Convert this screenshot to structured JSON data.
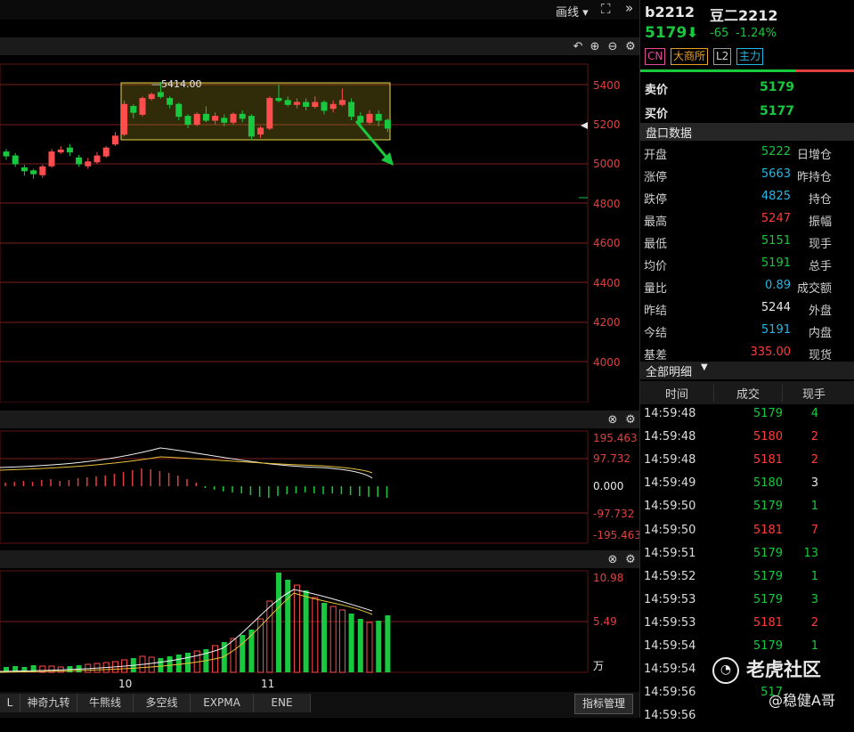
{
  "toolbar": {
    "draw_label": "画线 ▾",
    "fullscreen_icon": "expand-icon",
    "collapse_icon": "double-chevron-right-icon"
  },
  "chart_tools": [
    "undo-icon",
    "plus-circle-icon",
    "minus-circle-icon",
    "gear-icon"
  ],
  "kline": {
    "peak_label": "5414.00",
    "y_ticks": [
      "5400",
      "5200",
      "5000",
      "4800",
      "4600",
      "4400",
      "4200",
      "4000"
    ],
    "x_ticks": [
      "10",
      "11"
    ]
  },
  "macd": {
    "y_ticks": [
      "195.463",
      "97.732",
      "0.000",
      "-97.732",
      "-195.463"
    ]
  },
  "volume": {
    "y_ticks": [
      "10.98",
      "5.49",
      "万"
    ]
  },
  "bottom_tabs": [
    "L",
    "神奇九转",
    "牛熊线",
    "多空线",
    "EXPMA",
    "ENE"
  ],
  "indicator_button": "指标管理",
  "quote": {
    "code": "b2212",
    "name": "豆二2212",
    "price": "5179",
    "change": "-65",
    "change_pct": "-1.24%",
    "badges": [
      "CN",
      "大商所",
      "L2",
      "主力"
    ],
    "ask_label": "卖价",
    "ask": "5179",
    "bid_label": "买价",
    "bid": "5177",
    "section_title": "盘口数据",
    "rows": [
      {
        "l1": "开盘",
        "v": "5222",
        "l2": "日增仓",
        "c": "green"
      },
      {
        "l1": "涨停",
        "v": "5663",
        "l2": "昨持仓",
        "c": "cyan"
      },
      {
        "l1": "跌停",
        "v": "4825",
        "l2": "持仓",
        "c": "cyan"
      },
      {
        "l1": "最高",
        "v": "5247",
        "l2": "振幅",
        "c": "red"
      },
      {
        "l1": "最低",
        "v": "5151",
        "l2": "现手",
        "c": "green"
      },
      {
        "l1": "均价",
        "v": "5191",
        "l2": "总手",
        "c": "green"
      },
      {
        "l1": "量比",
        "v": "0.89",
        "l2": "成交额",
        "c": "cyan"
      },
      {
        "l1": "昨结",
        "v": "5244",
        "l2": "外盘",
        "c": "white"
      },
      {
        "l1": "今结",
        "v": "5191",
        "l2": "内盘",
        "c": "cyan"
      },
      {
        "l1": "基差",
        "v": "335.00",
        "l2": "现货",
        "c": "red"
      }
    ],
    "detail_title": "全部明细",
    "table_headers": [
      "时间",
      "成交",
      "现手"
    ],
    "trades": [
      {
        "t": "14:59:48",
        "p": "5179",
        "v": "4",
        "c": "green"
      },
      {
        "t": "14:59:48",
        "p": "5180",
        "v": "2",
        "c": "red"
      },
      {
        "t": "14:59:48",
        "p": "5181",
        "v": "2",
        "c": "red"
      },
      {
        "t": "14:59:49",
        "p": "5180",
        "v": "3",
        "c": "white"
      },
      {
        "t": "14:59:50",
        "p": "5179",
        "v": "1",
        "c": "green"
      },
      {
        "t": "14:59:50",
        "p": "5181",
        "v": "7",
        "c": "red"
      },
      {
        "t": "14:59:51",
        "p": "5179",
        "v": "13",
        "c": "green"
      },
      {
        "t": "14:59:52",
        "p": "5179",
        "v": "1",
        "c": "green"
      },
      {
        "t": "14:59:53",
        "p": "5179",
        "v": "3",
        "c": "green"
      },
      {
        "t": "14:59:53",
        "p": "5181",
        "v": "2",
        "c": "red"
      },
      {
        "t": "14:59:54",
        "p": "5179",
        "v": "1",
        "c": "green"
      },
      {
        "t": "14:59:54",
        "p": "",
        "v": "",
        "c": "green"
      },
      {
        "t": "14:59:56",
        "p": "517",
        "v": "",
        "c": "green"
      },
      {
        "t": "14:59:56",
        "p": "",
        "v": "",
        "c": "green"
      }
    ]
  },
  "watermark": {
    "brand": "老虎社区",
    "author": "@稳健A哥"
  }
}
